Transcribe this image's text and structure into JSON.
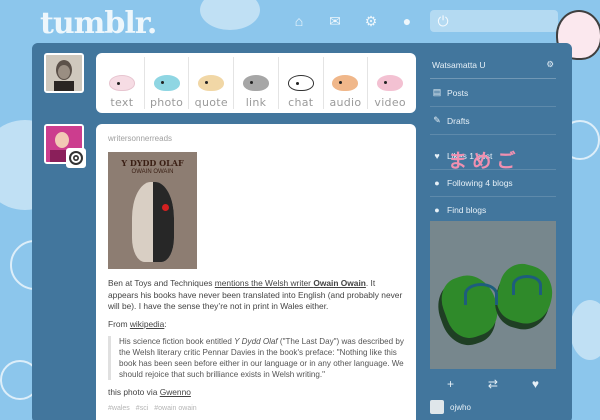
{
  "header": {
    "logo": "tumblr.",
    "search_placeholder": "",
    "nav_icons": [
      "home-icon",
      "mail-icon",
      "gear-icon",
      "user-icon",
      "power-icon"
    ]
  },
  "post_types": [
    {
      "label": "text",
      "color": "#f6dce4"
    },
    {
      "label": "photo",
      "color": "#8fd6e3"
    },
    {
      "label": "quote",
      "color": "#f1d7a6"
    },
    {
      "label": "link",
      "color": "#a6a6a6"
    },
    {
      "label": "chat",
      "color": "#ffffff"
    },
    {
      "label": "audio",
      "color": "#f0b78a"
    },
    {
      "label": "video",
      "color": "#f3c1d2"
    }
  ],
  "post": {
    "author": "writersonnerreads",
    "book_title": "Y DYDD OLAF",
    "book_author": "OWAIN OWAIN",
    "para1_a": "Ben at Toys and Techniques ",
    "para1_link": "mentions the Welsh writer ",
    "para1_bold": "Owain Owain",
    "para1_b": ". It appears his books have never been translated into English (and probably never will be). I have the sense they’re not in print in Wales either.",
    "from_label": "From ",
    "from_link": "wikipedia",
    "from_colon": ":",
    "quote_a": "His science fiction book entitled ",
    "quote_title": "Y Dydd Olaf",
    "quote_b": " (\"The Last Day\") was described by the Welsh literary critic Pennar Davies in the book's preface: \"Nothing like this book has been seen before either in our language or in any other language. We should rejoice that such brilliance exists in Welsh writing.\"",
    "via_a": "this photo via ",
    "via_link": "Gwenno",
    "tags": [
      "#wales",
      "#sci",
      "#owain owain"
    ]
  },
  "sidebar": {
    "blog_name": "Watsamatta U",
    "items": [
      {
        "label": "Posts",
        "icon": "posts-icon"
      },
      {
        "label": "Drafts",
        "icon": "drafts-icon"
      }
    ],
    "likes": "Likes 1 post",
    "following": "Following 4 blogs",
    "find": "Find blogs",
    "radar_foot": "ojwho"
  }
}
